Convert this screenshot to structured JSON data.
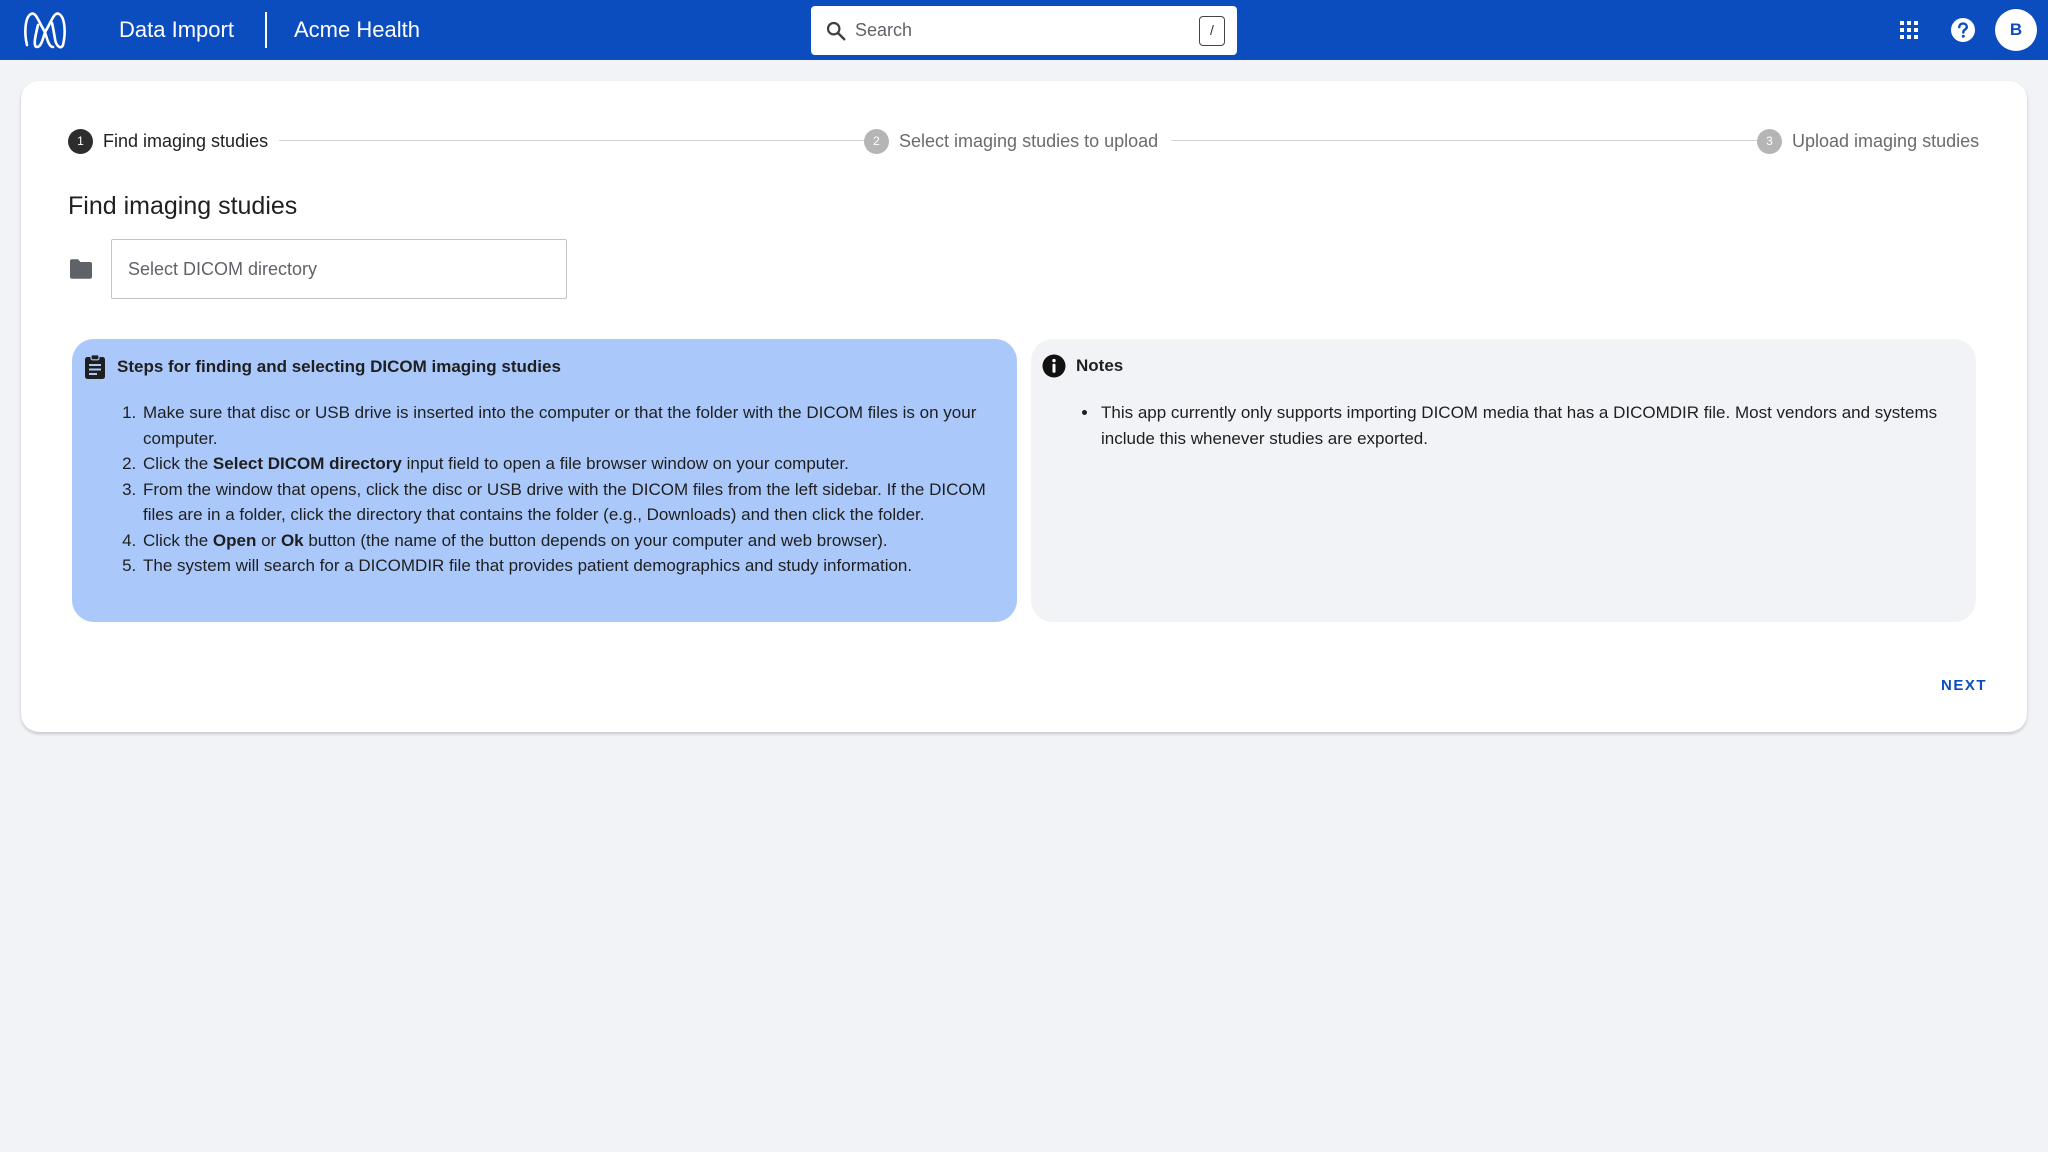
{
  "header": {
    "app_title": "Data Import",
    "org_name": "Acme Health",
    "search": {
      "placeholder": "Search",
      "shortcut_key": "/"
    },
    "avatar_initial": "B",
    "icons": [
      "m-logo-icon",
      "search-icon",
      "apps-grid-icon",
      "help-icon"
    ],
    "brand_color": "#0b4dbf"
  },
  "stepper": {
    "steps": [
      {
        "number": "1",
        "label": "Find imaging studies",
        "state": "active"
      },
      {
        "number": "2",
        "label": "Select imaging studies to upload",
        "state": "inactive"
      },
      {
        "number": "3",
        "label": "Upload imaging studies",
        "state": "inactive"
      }
    ]
  },
  "main": {
    "title": "Find imaging studies",
    "directory_input": {
      "placeholder": "Select DICOM directory",
      "value": ""
    },
    "steps_panel": {
      "title": "Steps for finding and selecting DICOM imaging studies",
      "icon": "clipboard-icon",
      "background": "#aac8fa",
      "items": [
        {
          "text": "Make sure that disc or USB drive is inserted into the computer or that the folder with the DICOM files is on your computer."
        },
        {
          "before": "Click the ",
          "bold1": "Select DICOM directory",
          "after": " input field to open a file browser window on your computer."
        },
        {
          "text": "From the window that opens, click the disc or USB drive with the DICOM files from the left sidebar. If the DICOM files are in a folder, click the directory that contains the folder (e.g., Downloads) and then click the folder."
        },
        {
          "before": "Click the ",
          "bold1": "Open",
          "middle": " or ",
          "bold2": "Ok",
          "after": " button (the name of the button depends on your computer and web browser)."
        },
        {
          "text": "The system will search for a DICOMDIR file that provides patient demographics and study information."
        }
      ]
    },
    "notes_panel": {
      "title": "Notes",
      "icon": "info-icon",
      "items": [
        "This app currently only supports importing DICOM media that has a DICOMDIR file. Most vendors and systems include this whenever studies are exported."
      ]
    },
    "next_label": "NEXT"
  }
}
